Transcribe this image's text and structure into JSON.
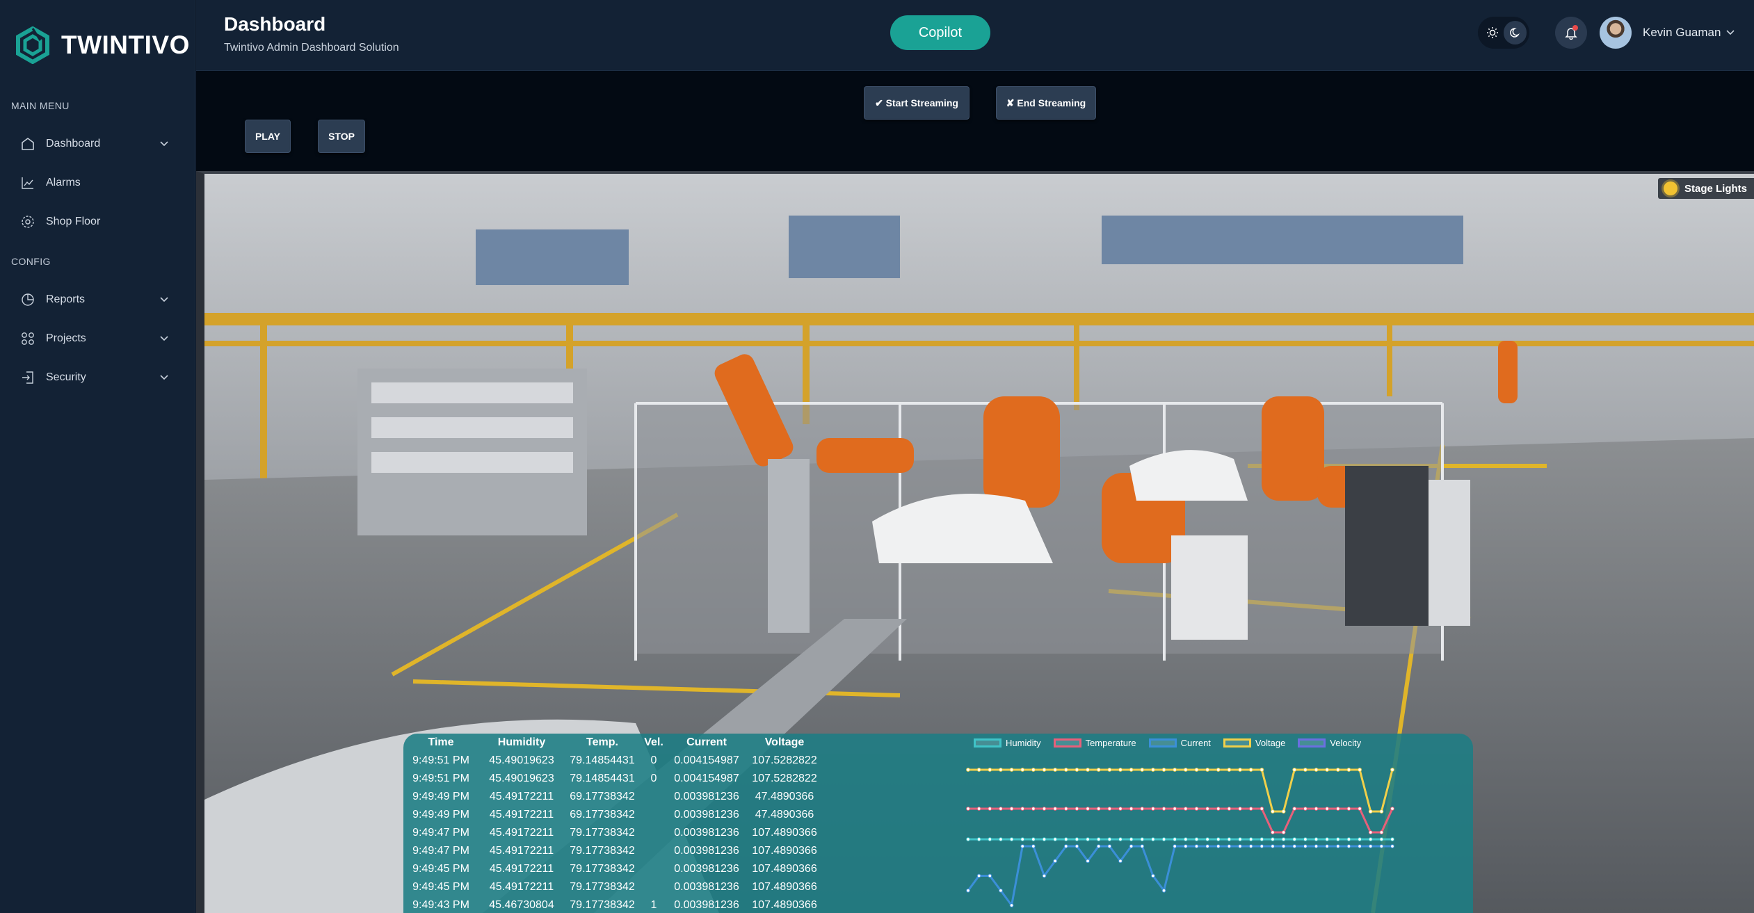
{
  "brand": {
    "name": "TWINTIVO"
  },
  "sidebar": {
    "sections": [
      {
        "label": "MAIN MENU"
      },
      {
        "label": "CONFIG"
      }
    ],
    "items": [
      {
        "label": "Dashboard",
        "icon": "home-icon"
      },
      {
        "label": "Alarms",
        "icon": "line-chart-icon"
      },
      {
        "label": "Shop Floor",
        "icon": "gear-icon"
      },
      {
        "label": "Reports",
        "icon": "pie-chart-icon"
      },
      {
        "label": "Projects",
        "icon": "grid-icon"
      },
      {
        "label": "Security",
        "icon": "login-icon"
      }
    ]
  },
  "header": {
    "title": "Dashboard",
    "subtitle": "Twintivo Admin Dashboard Solution",
    "copilot_label": "Copilot",
    "user_name": "Kevin Guaman"
  },
  "controls": {
    "start_streaming": "✔ Start Streaming",
    "end_streaming": "✘ End Streaming",
    "play": "PLAY",
    "stop": "STOP"
  },
  "viewport": {
    "stage_lights_label": "Stage Lights"
  },
  "telemetry": {
    "columns": [
      "Time",
      "Humidity",
      "Temp.",
      "Vel.",
      "Current",
      "Voltage"
    ],
    "rows": [
      [
        "9:49:51 PM",
        "45.49019623",
        "79.14854431",
        "0",
        "0.004154987",
        "107.5282822"
      ],
      [
        "9:49:51 PM",
        "45.49019623",
        "79.14854431",
        "0",
        "0.004154987",
        "107.5282822"
      ],
      [
        "9:49:49 PM",
        "45.49172211",
        "69.17738342",
        "",
        "0.003981236",
        "47.4890366"
      ],
      [
        "9:49:49 PM",
        "45.49172211",
        "69.17738342",
        "",
        "0.003981236",
        "47.4890366"
      ],
      [
        "9:49:47 PM",
        "45.49172211",
        "79.17738342",
        "",
        "0.003981236",
        "107.4890366"
      ],
      [
        "9:49:47 PM",
        "45.49172211",
        "79.17738342",
        "",
        "0.003981236",
        "107.4890366"
      ],
      [
        "9:49:45 PM",
        "45.49172211",
        "79.17738342",
        "",
        "0.003981236",
        "107.4890366"
      ],
      [
        "9:49:45 PM",
        "45.49172211",
        "79.17738342",
        "",
        "0.003981236",
        "107.4890366"
      ],
      [
        "9:49:43 PM",
        "45.46730804",
        "79.17738342",
        "1",
        "0.003981236",
        "107.4890366"
      ]
    ]
  },
  "chart_data": {
    "type": "line",
    "legend_position": "top",
    "grid": false,
    "series": [
      {
        "name": "Humidity",
        "color": "#40c4c8",
        "values": [
          45,
          45,
          45,
          45,
          45,
          45,
          45,
          45,
          45,
          45,
          45,
          45,
          45,
          45,
          45,
          45,
          45,
          45,
          45,
          45,
          45,
          45,
          45,
          45,
          45,
          45,
          45,
          45,
          45,
          45,
          45,
          45,
          45,
          45,
          45,
          45,
          45,
          45,
          45,
          45
        ]
      },
      {
        "name": "Temperature",
        "color": "#e8607a",
        "values": [
          79,
          79,
          79,
          79,
          79,
          79,
          79,
          79,
          79,
          79,
          79,
          79,
          79,
          79,
          79,
          79,
          79,
          79,
          79,
          79,
          79,
          79,
          79,
          79,
          79,
          79,
          79,
          79,
          79,
          79,
          79,
          79,
          79,
          79,
          79,
          79,
          79,
          79,
          79,
          79
        ]
      },
      {
        "name": "Current",
        "color": "#3b8fd8",
        "values": [
          0.5,
          1,
          1,
          0.5,
          0,
          2,
          2,
          1,
          1.5,
          2,
          2,
          1.5,
          2,
          2,
          1.5,
          2,
          2,
          1,
          0.5,
          2,
          2,
          2,
          2,
          2,
          2,
          2,
          2,
          2,
          2,
          2,
          2,
          2,
          2,
          2,
          2,
          2,
          2,
          2,
          2,
          2
        ]
      },
      {
        "name": "Voltage",
        "color": "#f1d04a",
        "values": [
          107,
          107,
          107,
          107,
          107,
          107,
          107,
          107,
          107,
          107,
          107,
          107,
          107,
          107,
          107,
          107,
          107,
          107,
          107,
          107,
          107,
          107,
          107,
          107,
          107,
          107,
          107,
          107,
          47,
          47,
          107,
          107,
          107,
          107,
          107,
          107,
          107,
          47,
          47,
          107
        ]
      },
      {
        "name": "Velocity",
        "color": "#6b6fe0",
        "values": []
      }
    ]
  },
  "colors": {
    "accent": "#1aa295",
    "sidebar_bg": "#132235",
    "overlay": "#1c7d84"
  }
}
